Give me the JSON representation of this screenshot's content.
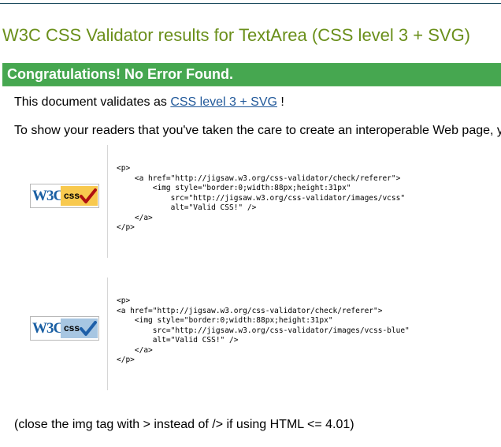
{
  "page": {
    "title": "W3C CSS Validator results for TextArea (CSS level 3 + SVG)"
  },
  "banner": {
    "text": "Congratulations! No Error Found."
  },
  "validates": {
    "prefix": "This document validates as",
    "link": "CSS level 3 + SVG",
    "suffix": "!"
  },
  "readers_text": "To show your readers that you've taken the care to create an interoperable Web page, y",
  "badges": [
    {
      "logo": "W3C",
      "label": "css",
      "check_icon": "red-check-icon",
      "panel_color": "#f8c94e",
      "check_color": "#b01010",
      "code": "<p>\n    <a href=\"http://jigsaw.w3.org/css-validator/check/referer\">\n        <img style=\"border:0;width:88px;height:31px\"\n            src=\"http://jigsaw.w3.org/css-validator/images/vcss\"\n            alt=\"Valid CSS!\" />\n    </a>\n</p>"
    },
    {
      "logo": "W3C",
      "label": "css",
      "check_icon": "blue-check-icon",
      "panel_color": "#a7c6e2",
      "check_color": "#1e5fa8",
      "code": "<p>\n<a href=\"http://jigsaw.w3.org/css-validator/check/referer\">\n    <img style=\"border:0;width:88px;height:31px\"\n        src=\"http://jigsaw.w3.org/css-validator/images/vcss-blue\"\n        alt=\"Valid CSS!\" />\n    </a>\n</p>"
    }
  ],
  "footer_note": "(close the img tag with > instead of /> if using HTML <= 4.01)"
}
